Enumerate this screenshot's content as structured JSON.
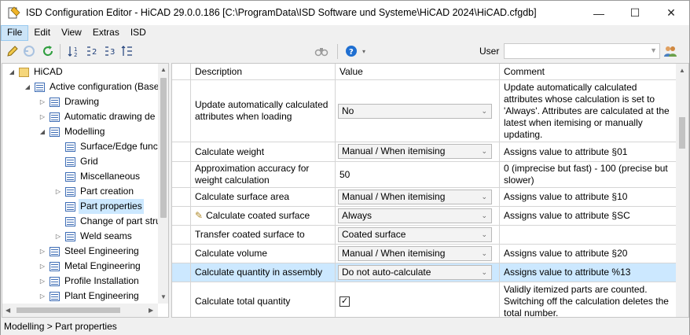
{
  "window": {
    "title": "ISD Configuration Editor  -  HiCAD 29.0.0.186 [C:\\ProgramData\\ISD Software und Systeme\\HiCAD 2024\\HiCAD.cfgdb]",
    "minimize": "—",
    "maximize": "☐",
    "close": "✕"
  },
  "menu": [
    "File",
    "Edit",
    "View",
    "Extras",
    "ISD"
  ],
  "toolbar": {
    "user_label": "User",
    "user_value": ""
  },
  "tree": {
    "nodes": [
      {
        "label": "HiCAD",
        "level": 0,
        "expanded": true
      },
      {
        "label": "Active configuration (Base",
        "level": 1,
        "expanded": true
      },
      {
        "label": "Drawing",
        "level": 2,
        "expanded": false
      },
      {
        "label": "Automatic drawing de",
        "level": 2,
        "expanded": false
      },
      {
        "label": "Modelling",
        "level": 2,
        "expanded": true
      },
      {
        "label": "Surface/Edge functi",
        "level": 3
      },
      {
        "label": "Grid",
        "level": 3
      },
      {
        "label": "Miscellaneous",
        "level": 3
      },
      {
        "label": "Part creation",
        "level": 3,
        "expanded": false
      },
      {
        "label": "Part properties",
        "level": 3,
        "selected": true
      },
      {
        "label": "Change of part stru",
        "level": 3
      },
      {
        "label": "Weld seams",
        "level": 3,
        "expanded": false
      },
      {
        "label": "Steel Engineering",
        "level": 2,
        "expanded": false
      },
      {
        "label": "Metal Engineering",
        "level": 2,
        "expanded": false
      },
      {
        "label": "Profile Installation",
        "level": 2,
        "expanded": false
      },
      {
        "label": "Plant Engineering",
        "level": 2,
        "expanded": false
      }
    ]
  },
  "grid": {
    "headers": {
      "description": "Description",
      "value": "Value",
      "comment": "Comment"
    },
    "rows": [
      {
        "description": "Update automatically calculated attributes when loading",
        "value": "No",
        "value_type": "select",
        "comment": "Update automatically calculated attributes whose calculation is set to 'Always'. Attributes are calculated at the latest when itemising or manually updating."
      },
      {
        "description": "Calculate weight",
        "value": "Manual / When itemising",
        "value_type": "select",
        "comment": "Assigns value to attribute §01"
      },
      {
        "description": "Approximation accuracy for weight calculation",
        "value": "50",
        "value_type": "text",
        "comment": "0 (imprecise but fast) - 100 (precise but slower)"
      },
      {
        "description": "Calculate surface area",
        "value": "Manual / When itemising",
        "value_type": "select",
        "comment": "Assigns value to attribute §10"
      },
      {
        "description": "Calculate coated surface",
        "value": "Always",
        "value_type": "select",
        "comment": "Assigns value to attribute §SC",
        "edited": true
      },
      {
        "description": "Transfer coated surface to",
        "value": "Coated surface",
        "value_type": "select",
        "comment": ""
      },
      {
        "description": "Calculate volume",
        "value": "Manual / When itemising",
        "value_type": "select",
        "comment": "Assigns value to attribute §20"
      },
      {
        "description": "Calculate quantity in assembly",
        "value": "Do not auto-calculate",
        "value_type": "select",
        "comment": "Assigns value to attribute %13",
        "selected": true
      },
      {
        "description": "Calculate total quantity",
        "value": "",
        "value_type": "checkbox",
        "checked": true,
        "comment": "Validly itemized parts are counted. Switching off the calculation deletes the total number."
      }
    ]
  },
  "status": {
    "path": "Modelling > Part properties"
  }
}
